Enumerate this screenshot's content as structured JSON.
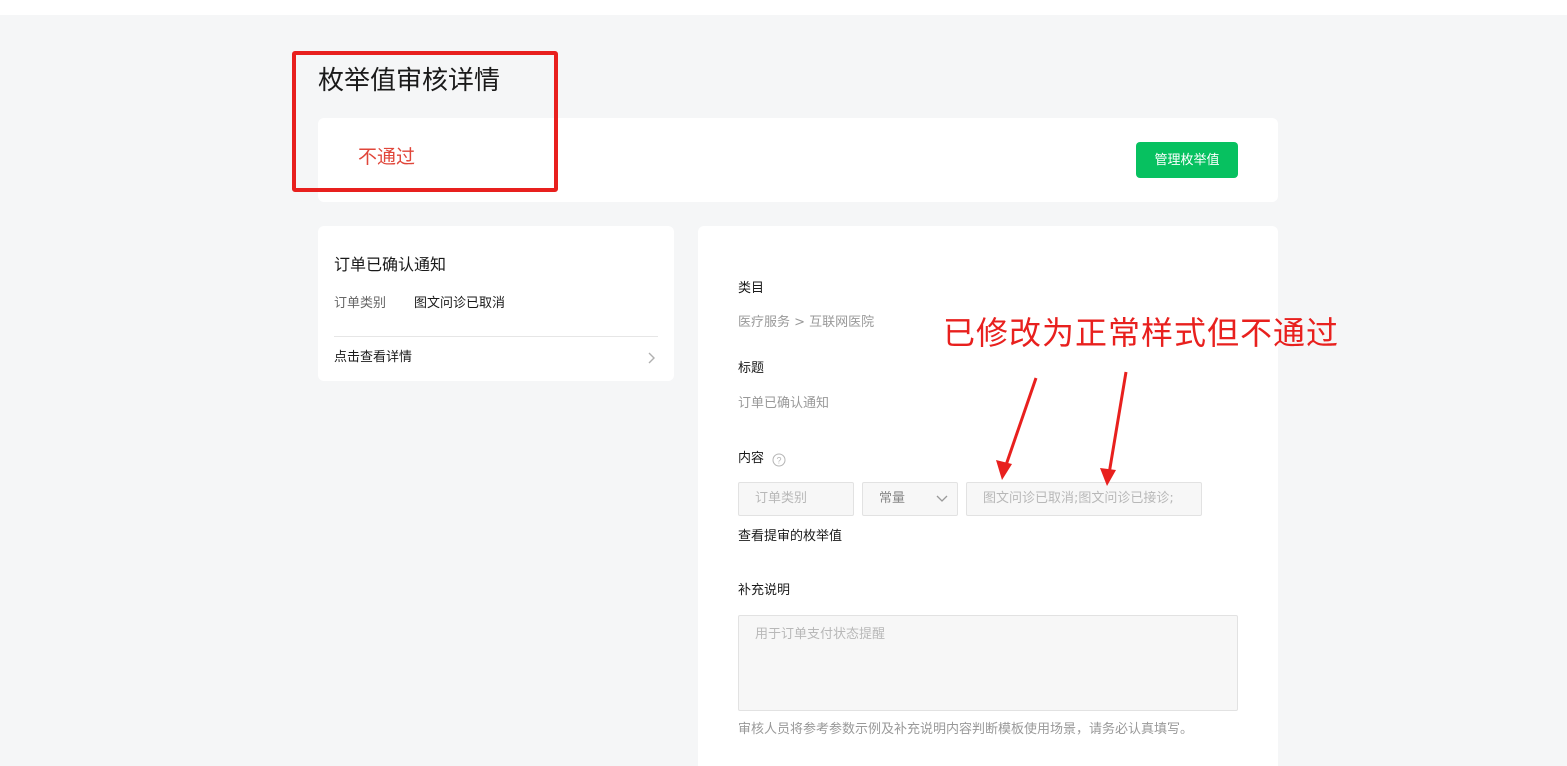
{
  "page": {
    "title": "枚举值审核详情"
  },
  "status": {
    "text": "不通过",
    "manage_button": "管理枚举值"
  },
  "template_card": {
    "title": "订单已确认通知",
    "field_label": "订单类别",
    "field_value": "图文问诊已取消",
    "detail_link": "点击查看详情"
  },
  "detail": {
    "category_label": "类目",
    "category_value": "医疗服务 > 互联网医院",
    "title_label": "标题",
    "title_value": "订单已确认通知",
    "content_label": "内容",
    "content_fields": {
      "name": "订单类别",
      "type": "常量",
      "value": "图文问诊已取消;图文问诊已接诊;"
    },
    "view_enum_link": "查看提审的枚举值",
    "supplement_label": "补充说明",
    "supplement_value": "用于订单支付状态提醒",
    "note": "审核人员将参考参数示例及补充说明内容判断模板使用场景，请务必认真填写。"
  },
  "annotation": {
    "text": "已修改为正常样式但不通过"
  },
  "colors": {
    "primary": "#07c160",
    "reject": "#e0463a",
    "annotation": "#e8201e",
    "background": "#f5f6f7"
  }
}
